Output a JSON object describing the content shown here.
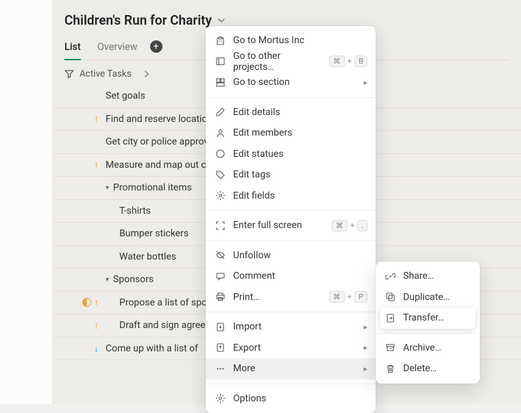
{
  "title": "Children's Run for Charity",
  "tabs": {
    "list": "List",
    "overview": "Overview"
  },
  "filter": "Active Tasks",
  "tasks": [
    {
      "text": "Set goals"
    },
    {
      "arrow": "up",
      "text": "Find and reserve location"
    },
    {
      "text": "Get city or police approval"
    },
    {
      "arrow": "up",
      "text": "Measure and map out course"
    },
    {
      "disclose": true,
      "text": "Promotional items"
    },
    {
      "indent": 1,
      "text": "T-shirts"
    },
    {
      "indent": 1,
      "text": "Bumper stickers"
    },
    {
      "indent": 1,
      "text": "Water bottles"
    },
    {
      "disclose": true,
      "text": "Sponsors"
    },
    {
      "half": true,
      "arrow": "up",
      "indent": 1,
      "text": "Propose a list of sponsors"
    },
    {
      "arrow": "up",
      "indent": 1,
      "text": "Draft and sign agreement"
    },
    {
      "arrow": "down",
      "text": "Come up with a list of"
    }
  ],
  "menu": {
    "go_mortus": "Go to Mortus Inc",
    "go_projects": "Go to other projects…",
    "go_section": "Go to section",
    "edit_details": "Edit details",
    "edit_members": "Edit members",
    "edit_statues": "Edit statues",
    "edit_tags": "Edit tags",
    "edit_fields": "Edit fields",
    "full_screen": "Enter full screen",
    "unfollow": "Unfollow",
    "comment": "Comment",
    "print": "Print…",
    "import": "Import",
    "export": "Export",
    "more": "More",
    "options": "Options",
    "kbd_cmd": "⌘",
    "kbd_b": "B",
    "kbd_dot": ".",
    "kbd_p": "P",
    "plus": "+"
  },
  "submenu": {
    "share": "Share…",
    "duplicate": "Duplicate…",
    "transfer": "Transfer…",
    "archive": "Archive…",
    "delete": "Delete…"
  }
}
